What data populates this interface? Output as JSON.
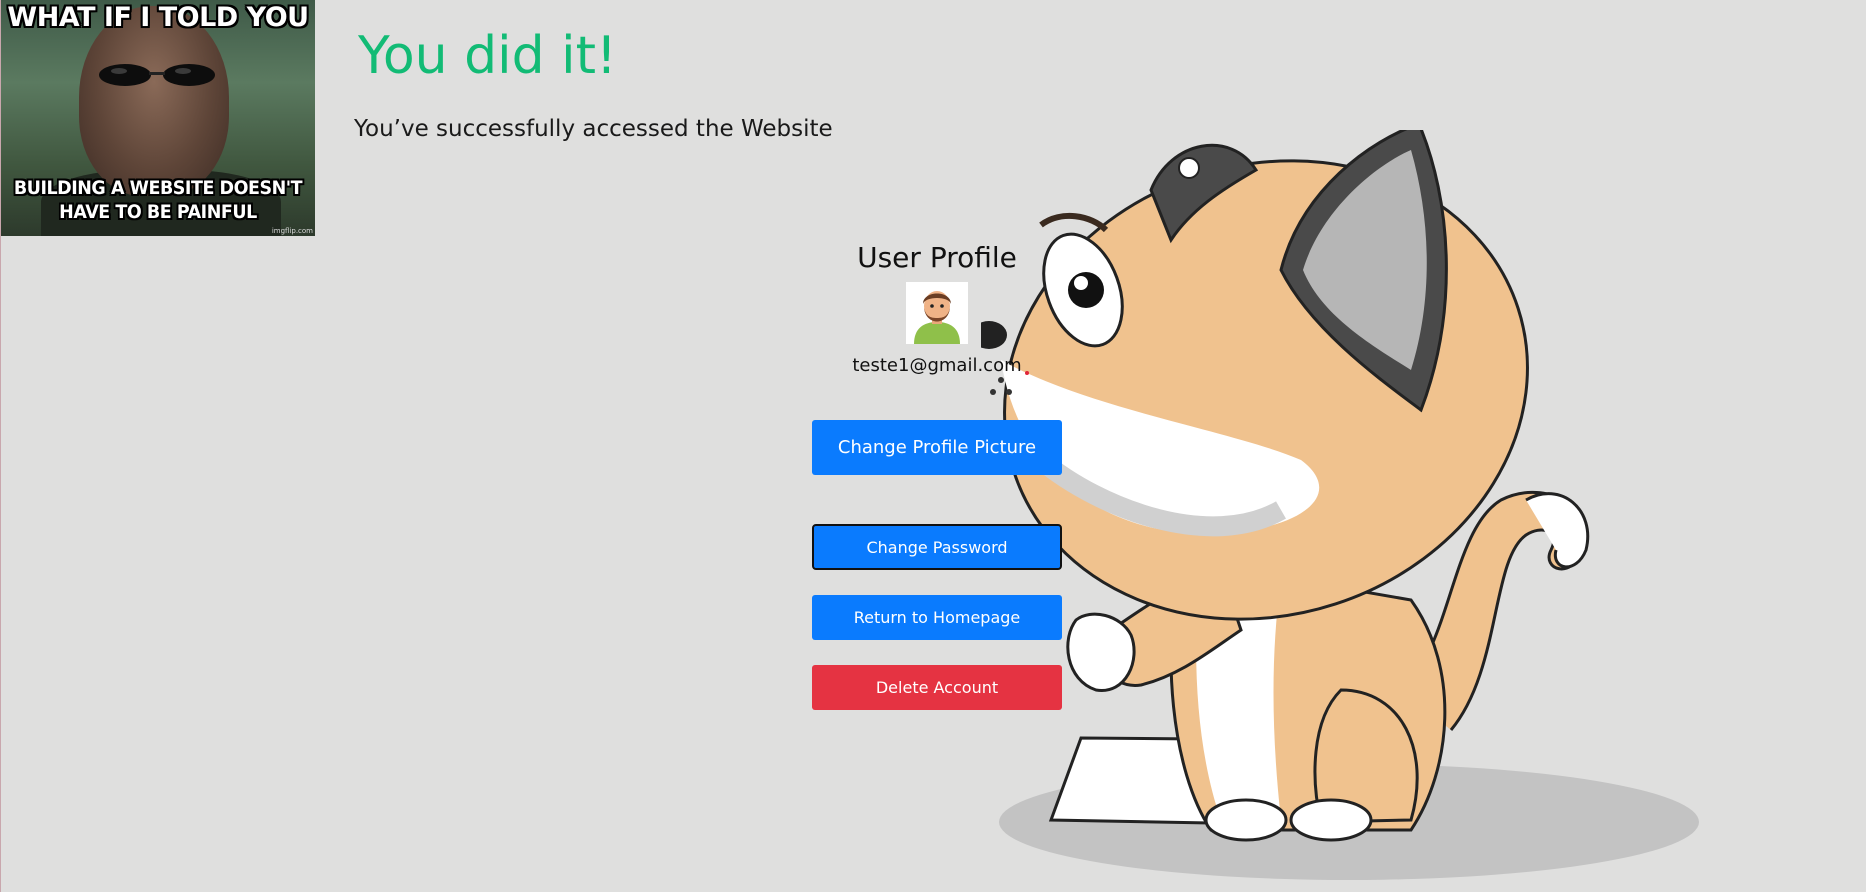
{
  "meme": {
    "top_text": "WHAT IF I TOLD YOU",
    "bottom_text": "BUILDING A WEBSITE DOESN'T HAVE TO BE PAINFUL",
    "watermark": "imgflip.com"
  },
  "header": {
    "title": "You did it!",
    "subtitle": "You’ve successfully accessed the Website"
  },
  "profile": {
    "title": "User Profile",
    "email": "teste1@gmail.com"
  },
  "actions": {
    "change_picture": "Change Profile Picture",
    "change_password": "Change Password",
    "return_home": "Return to Homepage",
    "delete_account": "Delete Account"
  },
  "colors": {
    "background": "#dfdfde",
    "title_green": "#12bb75",
    "primary_blue": "#0a7bfe",
    "danger_red": "#e53342"
  },
  "icons": [
    "user-avatar-icon",
    "cat-illustration"
  ]
}
